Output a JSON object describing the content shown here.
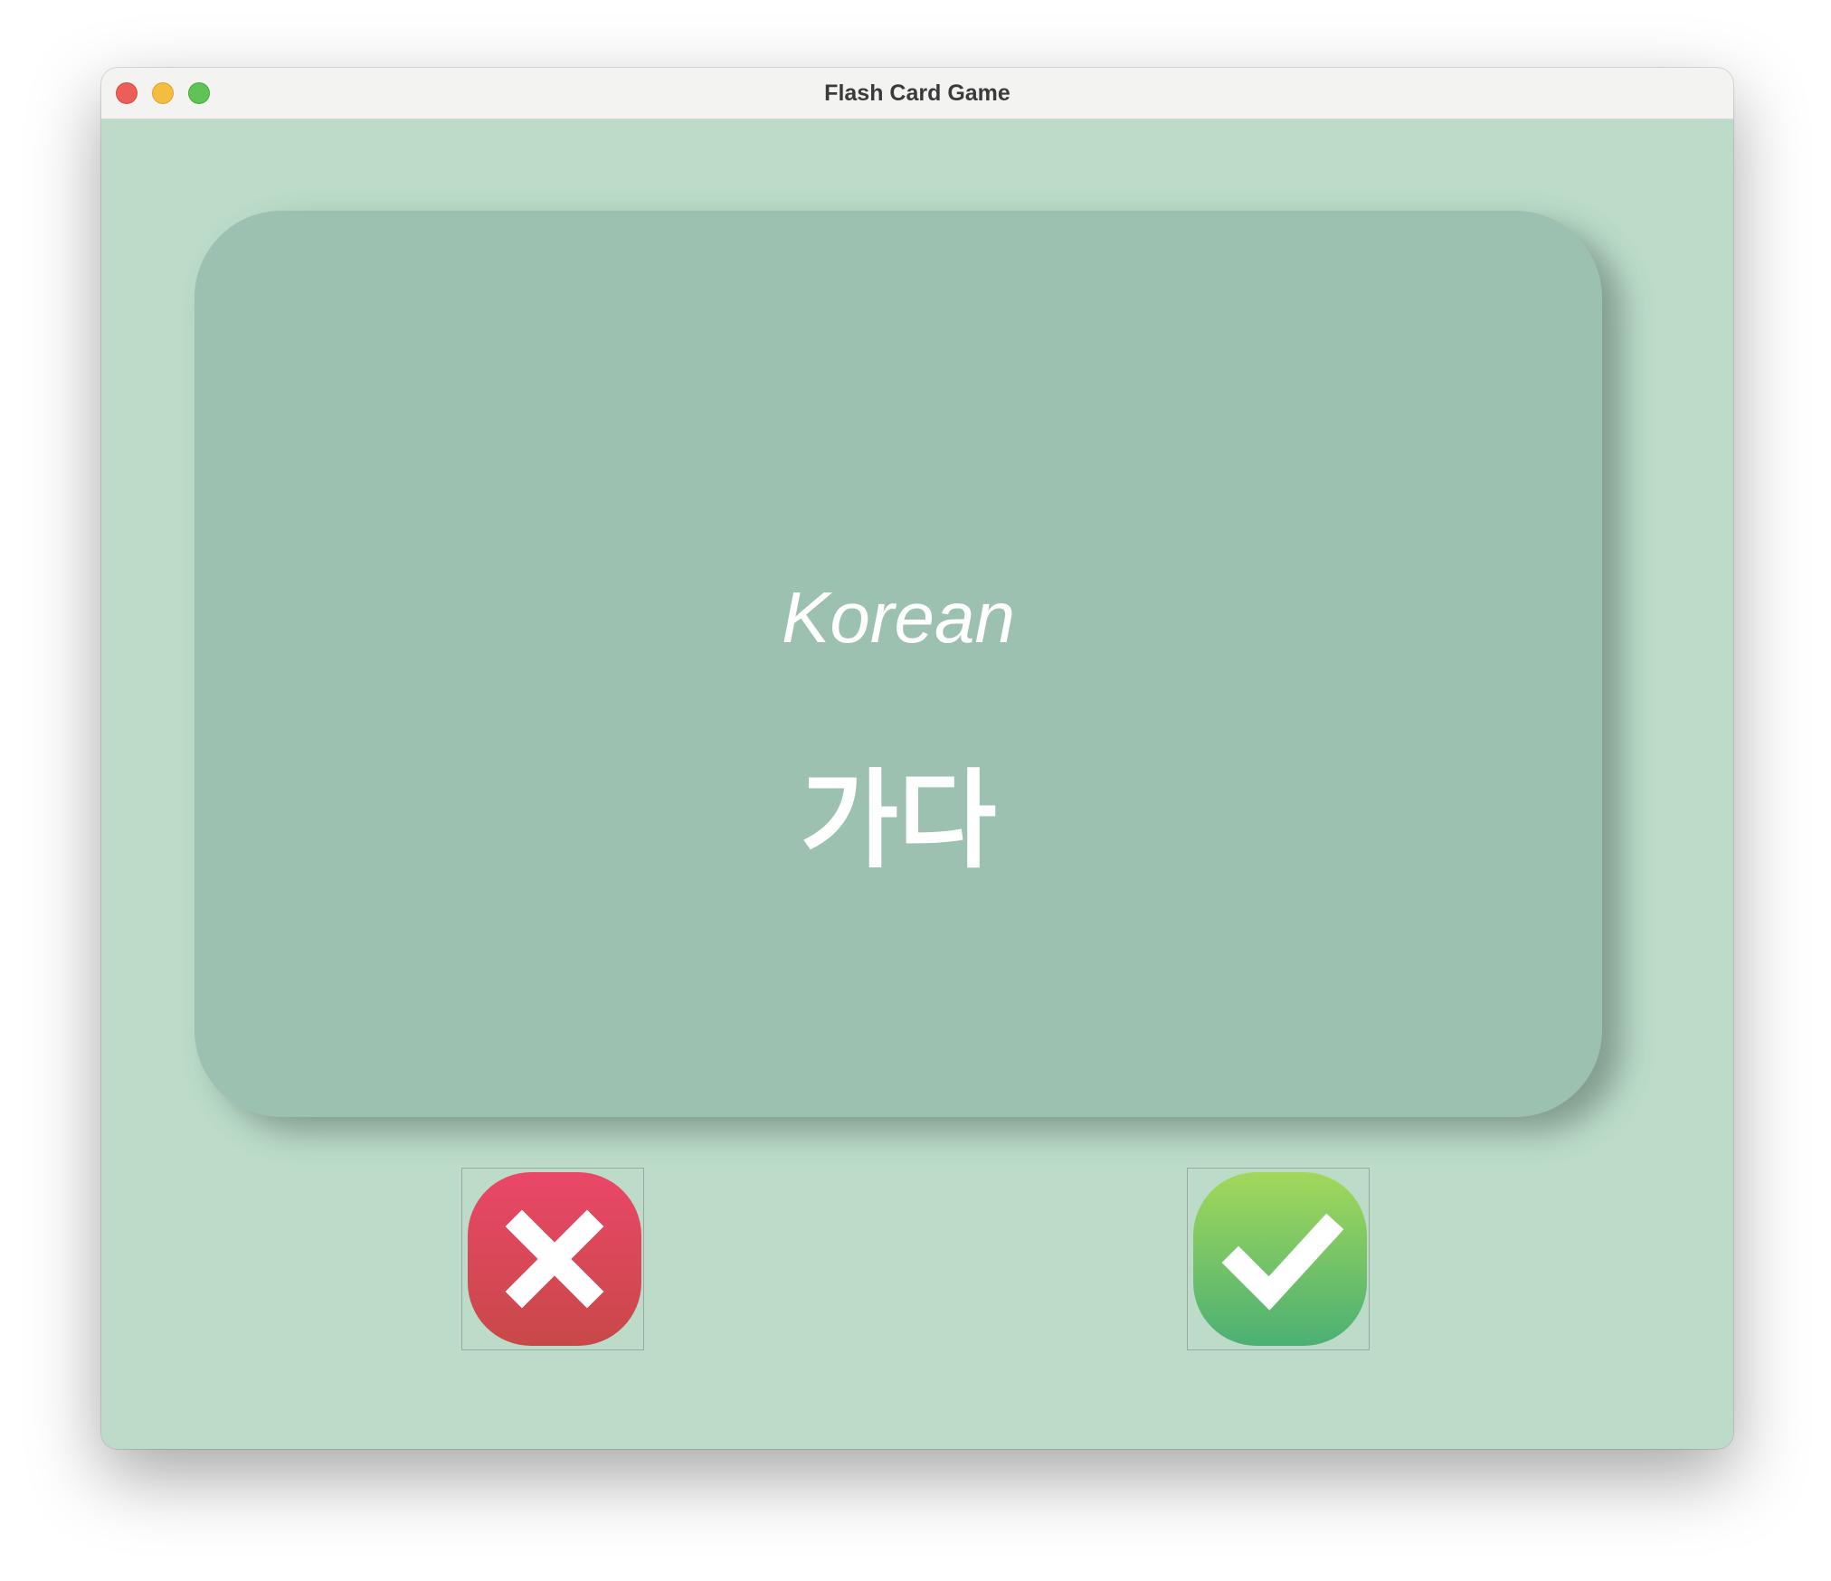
{
  "window": {
    "title": "Flash Card Game"
  },
  "card": {
    "language": "Korean",
    "word": "가다"
  },
  "buttons": {
    "wrong_icon": "x-mark-icon",
    "right_icon": "checkmark-icon"
  },
  "colors": {
    "window_background": "#bcdcc9",
    "card_background": "#9cc1b0",
    "wrong_gradient_top": "#ea4768",
    "wrong_gradient_bottom": "#c84848",
    "right_gradient_top": "#a2d85a",
    "right_gradient_bottom": "#4bb074"
  }
}
